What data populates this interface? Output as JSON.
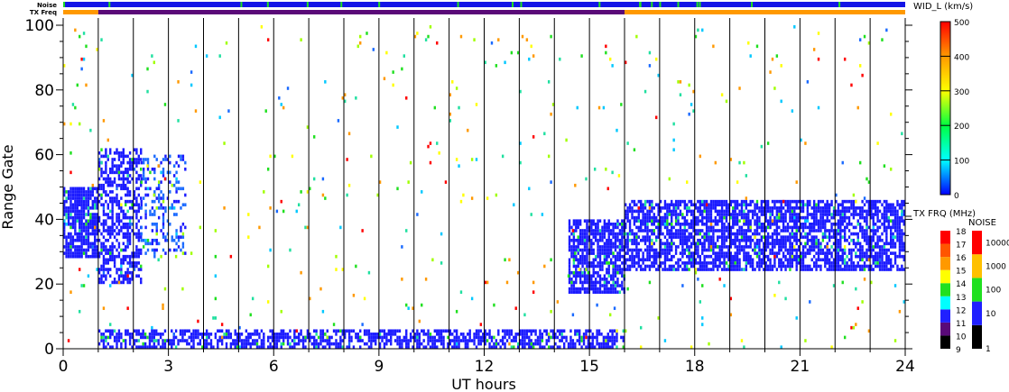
{
  "chart_data": {
    "type": "heatmap",
    "title": "",
    "xlabel": "UT hours",
    "ylabel": "Range Gate",
    "xlim": [
      0,
      24
    ],
    "ylim": [
      0,
      100
    ],
    "xticks": [
      "0",
      "3",
      "6",
      "9",
      "12",
      "15",
      "18",
      "21",
      "24"
    ],
    "yticks": [
      "0",
      "20",
      "40",
      "60",
      "80",
      "100"
    ],
    "hour_lines": [
      1,
      2,
      3,
      4,
      5,
      6,
      7,
      8,
      9,
      10,
      11,
      12,
      13,
      14,
      15,
      16,
      17,
      18,
      19,
      20,
      21,
      22,
      23
    ],
    "parameter": "WID_L (km/s)",
    "colorbar": {
      "label": "WID_L (km/s)",
      "ticks": [
        "0",
        "100",
        "200",
        "300",
        "400",
        "500"
      ],
      "range": [
        0,
        500
      ]
    },
    "txfreq_bar": {
      "label": "TX FRQ (MHz)",
      "ticks": [
        "9",
        "10",
        "11",
        "12",
        "13",
        "14",
        "15",
        "16",
        "17",
        "18"
      ],
      "colors": [
        "#000000",
        "#5a0a78",
        "#2020ff",
        "#00ffff",
        "#20e020",
        "#ffff00",
        "#ff9900",
        "#ff5500",
        "#ff0000"
      ]
    },
    "noise_bar": {
      "label": "NOISE",
      "ticks": [
        "1",
        "10",
        "100",
        "1000",
        "10000"
      ],
      "colors": [
        "#000000",
        "#2020ff",
        "#20e020",
        "#ffc000",
        "#ff0000"
      ]
    },
    "top_strips": {
      "noise_label": "Noise",
      "txfreq_label": "TX Freq",
      "txfreq_segments": [
        {
          "from": 0,
          "to": 1,
          "value_mhz": 15
        },
        {
          "from": 1,
          "to": 16,
          "value_mhz": 10
        },
        {
          "from": 16,
          "to": 24,
          "value_mhz": 15
        }
      ]
    },
    "scatter_regions": [
      {
        "t": [
          0,
          1
        ],
        "g": [
          28,
          50
        ],
        "density": 0.85,
        "width_kms": 20
      },
      {
        "t": [
          1,
          2.2
        ],
        "g": [
          20,
          62
        ],
        "density": 0.55,
        "width_kms": 30
      },
      {
        "t": [
          2.2,
          3.5
        ],
        "g": [
          28,
          60
        ],
        "density": 0.3,
        "width_kms": 60
      },
      {
        "t": [
          1,
          16
        ],
        "g": [
          0,
          6
        ],
        "density": 0.6,
        "width_kms": 20
      },
      {
        "t": [
          14.4,
          16
        ],
        "g": [
          17,
          40
        ],
        "density": 0.75,
        "width_kms": 20
      },
      {
        "t": [
          16,
          24
        ],
        "g": [
          24,
          46
        ],
        "density": 0.7,
        "width_kms": 20
      },
      {
        "t": [
          0,
          24
        ],
        "g": [
          0,
          100
        ],
        "density": 0.012,
        "width_kms": 250
      }
    ],
    "colors": {
      "axis": "#000000",
      "background": "#ffffff"
    }
  }
}
